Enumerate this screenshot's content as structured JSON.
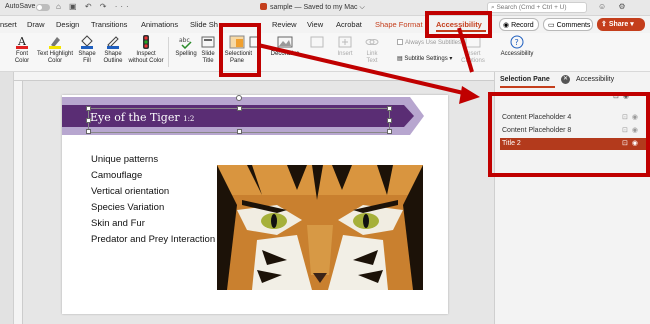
{
  "titlebar": {
    "autosave_label": "AutoSave",
    "doc_title": "sample — Saved to my Mac ⌵",
    "search_placeholder": "Search (Cmd + Ctrl + U)"
  },
  "tabs": [
    "nsert",
    "Draw",
    "Design",
    "Transitions",
    "Animations",
    "Slide Sh",
    "Review",
    "View",
    "Acrobat",
    "Shape Format",
    "Accessibility"
  ],
  "actions": {
    "record": "Record",
    "comments": "Comments",
    "share": "Share"
  },
  "ribbon": {
    "font_color": "Font\nColor",
    "text_highlight": "Text Highlight\nColor",
    "shape_fill": "Shape\nFill",
    "shape_outline": "Shape\nOutline",
    "inspect": "Inspect\nwithout Color",
    "spelling": "Spelling",
    "slide_title": "Slide\nTitle",
    "selection_pane": "Selection\nPane",
    "mark_decorative": "Decorative",
    "insert": "Insert",
    "link_text": "Link\nText",
    "always_use_subtitles": "Always Use Subtitles",
    "subtitle_settings": "Subtitle Settings",
    "insert_captions": "Insert\nCaptions",
    "accessibility": "Accessibility"
  },
  "slide": {
    "title": "Eye of the Tiger",
    "title_suffix": "1:2",
    "bullets": [
      "Unique patterns",
      "Camouflage",
      "Vertical orientation",
      "Species Variation",
      "Skin and Fur",
      "Predator and Prey Interaction"
    ]
  },
  "pane": {
    "tab_selection": "Selection Pane",
    "tab_accessibility": "Accessibility",
    "layers": [
      {
        "name": "Content Placeholder 4",
        "selected": false
      },
      {
        "name": "Content Placeholder 8",
        "selected": false
      },
      {
        "name": "Title 2",
        "selected": true
      }
    ]
  },
  "colors": {
    "accent": "#c43e1c",
    "annotation": "#c00000",
    "banner_dark": "#5a2d74",
    "banner_light": "#b7a6cf"
  }
}
